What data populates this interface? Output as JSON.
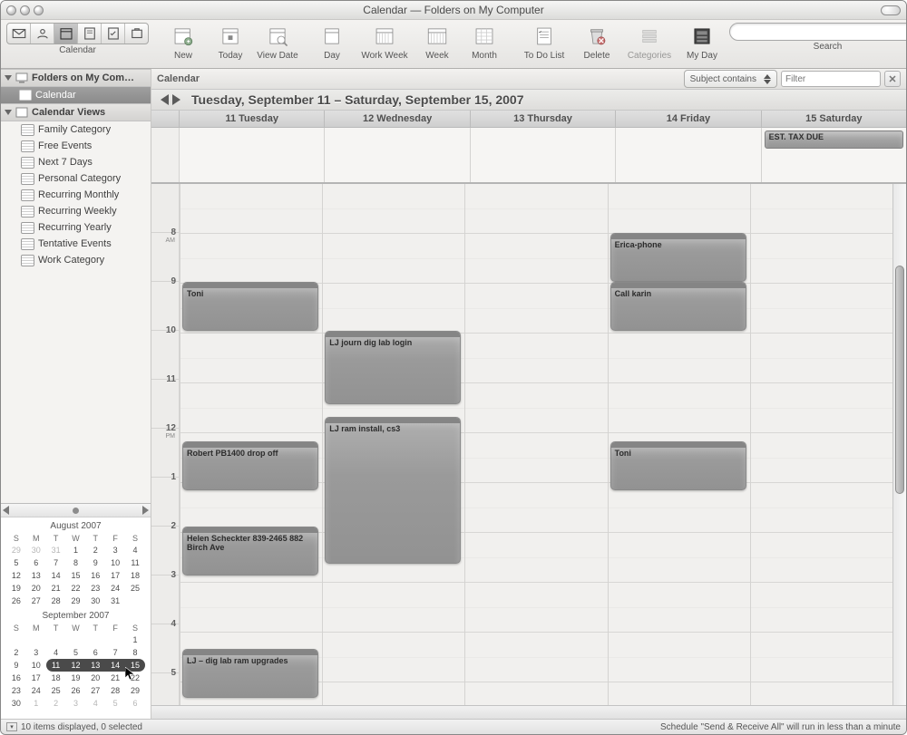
{
  "window_title": "Calendar — Folders on My Computer",
  "toolbar": {
    "cluster_label": "Calendar",
    "items": [
      {
        "id": "new",
        "label": "New"
      },
      {
        "id": "today",
        "label": "Today"
      },
      {
        "id": "viewdate",
        "label": "View Date"
      },
      {
        "id": "day",
        "label": "Day"
      },
      {
        "id": "workweek",
        "label": "Work Week"
      },
      {
        "id": "week",
        "label": "Week"
      },
      {
        "id": "month",
        "label": "Month"
      },
      {
        "id": "todo",
        "label": "To Do List"
      },
      {
        "id": "delete",
        "label": "Delete"
      },
      {
        "id": "categories",
        "label": "Categories"
      },
      {
        "id": "myday",
        "label": "My Day"
      }
    ],
    "search_label": "Search",
    "search_placeholder": ""
  },
  "sidebar": {
    "root_label": "Folders on My Com…",
    "calendar_label": "Calendar",
    "views_label": "Calendar Views",
    "views": [
      "Family Category",
      "Free Events",
      "Next 7 Days",
      "Personal Category",
      "Recurring Monthly",
      "Recurring Weekly",
      "Recurring Yearly",
      "Tentative Events",
      "Work Category"
    ]
  },
  "mini_calendars": {
    "aug": {
      "title": "August 2007",
      "dow": [
        "S",
        "M",
        "T",
        "W",
        "T",
        "F",
        "S"
      ],
      "rows": [
        [
          "29",
          "30",
          "31",
          "1",
          "2",
          "3",
          "4"
        ],
        [
          "5",
          "6",
          "7",
          "8",
          "9",
          "10",
          "11"
        ],
        [
          "12",
          "13",
          "14",
          "15",
          "16",
          "17",
          "18"
        ],
        [
          "19",
          "20",
          "21",
          "22",
          "23",
          "24",
          "25"
        ],
        [
          "26",
          "27",
          "28",
          "29",
          "30",
          "31",
          ""
        ]
      ],
      "out_first_row_count": 3
    },
    "sep": {
      "title": "September 2007",
      "dow": [
        "S",
        "M",
        "T",
        "W",
        "T",
        "F",
        "S"
      ],
      "rows": [
        [
          "",
          "",
          "",
          "",
          "",
          "",
          "1"
        ],
        [
          "2",
          "3",
          "4",
          "5",
          "6",
          "7",
          "8"
        ],
        [
          "9",
          "10",
          "11",
          "12",
          "13",
          "14",
          "15"
        ],
        [
          "16",
          "17",
          "18",
          "19",
          "20",
          "21",
          "22"
        ],
        [
          "23",
          "24",
          "25",
          "26",
          "27",
          "28",
          "29"
        ],
        [
          "30",
          "1",
          "2",
          "3",
          "4",
          "5",
          "6"
        ]
      ],
      "selected_days": [
        "11",
        "12",
        "13",
        "14",
        "15"
      ],
      "out_last_row_start": 1
    }
  },
  "calendar": {
    "header_label": "Calendar",
    "filter_subject": "Subject contains",
    "filter_placeholder": "Filter",
    "range_title": "Tuesday, September 11 – Saturday, September 15, 2007",
    "days": [
      "11 Tuesday",
      "12 Wednesday",
      "13 Thursday",
      "14 Friday",
      "15 Saturday"
    ],
    "hours": [
      {
        "n": "",
        "ampm": ""
      },
      {
        "n": "8",
        "ampm": "AM"
      },
      {
        "n": "9",
        "ampm": ""
      },
      {
        "n": "10",
        "ampm": ""
      },
      {
        "n": "11",
        "ampm": ""
      },
      {
        "n": "12",
        "ampm": "PM"
      },
      {
        "n": "1",
        "ampm": ""
      },
      {
        "n": "2",
        "ampm": ""
      },
      {
        "n": "3",
        "ampm": ""
      },
      {
        "n": "4",
        "ampm": ""
      },
      {
        "n": "5",
        "ampm": ""
      }
    ],
    "allday": [
      {
        "day": 4,
        "title": "EST. TAX  DUE"
      }
    ],
    "events": [
      {
        "day": 0,
        "title": "Toni",
        "start": 9,
        "span": 1
      },
      {
        "day": 0,
        "title": "Robert PB1400 drop off",
        "start": 12.25,
        "span": 1
      },
      {
        "day": 0,
        "title": "Helen Scheckter 839-2465 882 Birch Ave",
        "start": 14,
        "span": 1
      },
      {
        "day": 0,
        "title": "LJ – dig lab ram upgrades",
        "start": 16.5,
        "span": 1
      },
      {
        "day": 1,
        "title": "LJ  journ dig lab login",
        "start": 10,
        "span": 1.5
      },
      {
        "day": 1,
        "title": "LJ ram install, cs3",
        "start": 11.75,
        "span": 3
      },
      {
        "day": 3,
        "title": "Erica-phone",
        "start": 8,
        "span": 1
      },
      {
        "day": 3,
        "title": "Call karin",
        "start": 9,
        "span": 1
      },
      {
        "day": 3,
        "title": "Toni",
        "start": 12.25,
        "span": 1
      }
    ]
  },
  "status": {
    "left": "10 items displayed, 0 selected",
    "right": "Schedule \"Send & Receive All\" will run in less than a minute"
  }
}
